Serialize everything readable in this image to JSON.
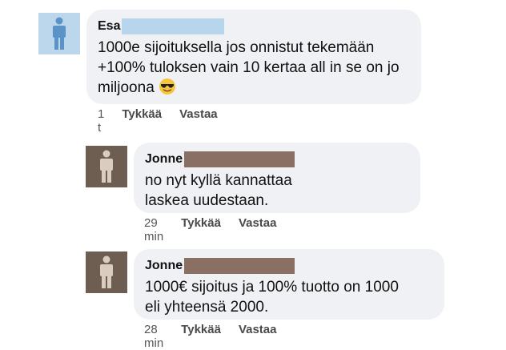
{
  "comments": [
    {
      "author": "Esa",
      "text": "1000e sijoituksella jos onnistut tekemään +100% tuloksen vain 10 kertaa all in se on jo miljoona",
      "emoji": "smiling-face-with-sunglasses",
      "time": "1 t",
      "like_label": "Tykkää",
      "reply_label": "Vastaa"
    },
    {
      "author": "Jonne",
      "text_lines": [
        "no nyt kyllä kannattaa",
        "laskea uudestaan."
      ],
      "time": "29 min",
      "like_label": "Tykkää",
      "reply_label": "Vastaa"
    },
    {
      "author": "Jonne",
      "text_lines": [
        "1000€ sijoitus ja 100% tuotto on 1000",
        "eli yhteensä 2000."
      ],
      "time": "28 min",
      "like_label": "Tykkää",
      "reply_label": "Vastaa"
    }
  ],
  "colors": {
    "bubble": "#f0f1f4",
    "avatar_blue": "#bcd7ec",
    "avatar_brown": "#6e5e51",
    "redact_blue": "#b7d5ec",
    "redact_brown": "#8a7064"
  }
}
